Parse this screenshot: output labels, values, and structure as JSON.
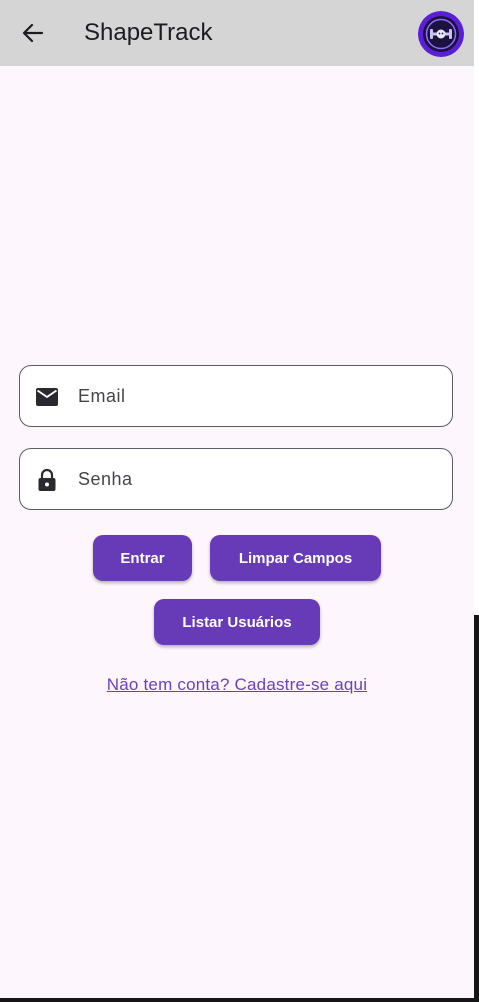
{
  "appbar": {
    "title": "ShapeTrack"
  },
  "form": {
    "email_placeholder": "Email",
    "password_placeholder": "Senha"
  },
  "buttons": {
    "login": "Entrar",
    "clear": "Limpar Campos",
    "list_users": "Listar Usuários"
  },
  "signup_link": "Não tem conta? Cadastre-se aqui",
  "colors": {
    "primary": "#673ab7",
    "background": "#fdf6fd",
    "appbar": "#d5d5d5"
  },
  "icons": {
    "back": "arrow-back-icon",
    "email": "mail-icon",
    "password": "lock-icon",
    "logo": "app-logo"
  }
}
